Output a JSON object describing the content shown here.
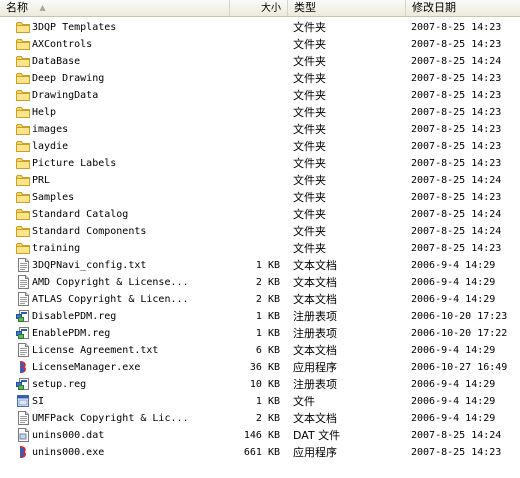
{
  "columns": {
    "name": "名称",
    "size": "大小",
    "type": "类型",
    "modified": "修改日期"
  },
  "files": [
    {
      "name": "3DQP Templates",
      "size": "",
      "type": "文件夹",
      "modified": "2007-8-25 14:23",
      "icon": "folder-icon"
    },
    {
      "name": "AXControls",
      "size": "",
      "type": "文件夹",
      "modified": "2007-8-25 14:23",
      "icon": "folder-icon"
    },
    {
      "name": "DataBase",
      "size": "",
      "type": "文件夹",
      "modified": "2007-8-25 14:24",
      "icon": "folder-icon"
    },
    {
      "name": "Deep Drawing",
      "size": "",
      "type": "文件夹",
      "modified": "2007-8-25 14:23",
      "icon": "folder-icon"
    },
    {
      "name": "DrawingData",
      "size": "",
      "type": "文件夹",
      "modified": "2007-8-25 14:23",
      "icon": "folder-icon"
    },
    {
      "name": "Help",
      "size": "",
      "type": "文件夹",
      "modified": "2007-8-25 14:23",
      "icon": "folder-icon"
    },
    {
      "name": "images",
      "size": "",
      "type": "文件夹",
      "modified": "2007-8-25 14:23",
      "icon": "folder-icon"
    },
    {
      "name": "laydie",
      "size": "",
      "type": "文件夹",
      "modified": "2007-8-25 14:23",
      "icon": "folder-icon"
    },
    {
      "name": "Picture Labels",
      "size": "",
      "type": "文件夹",
      "modified": "2007-8-25 14:23",
      "icon": "folder-icon"
    },
    {
      "name": "PRL",
      "size": "",
      "type": "文件夹",
      "modified": "2007-8-25 14:24",
      "icon": "folder-icon"
    },
    {
      "name": "Samples",
      "size": "",
      "type": "文件夹",
      "modified": "2007-8-25 14:23",
      "icon": "folder-icon"
    },
    {
      "name": "Standard Catalog",
      "size": "",
      "type": "文件夹",
      "modified": "2007-8-25 14:24",
      "icon": "folder-icon"
    },
    {
      "name": "Standard Components",
      "size": "",
      "type": "文件夹",
      "modified": "2007-8-25 14:24",
      "icon": "folder-icon"
    },
    {
      "name": "training",
      "size": "",
      "type": "文件夹",
      "modified": "2007-8-25 14:23",
      "icon": "folder-icon"
    },
    {
      "name": "3DQPNavi_config.txt",
      "size": "1 KB",
      "type": "文本文档",
      "modified": "2006-9-4 14:29",
      "icon": "text-file-icon"
    },
    {
      "name": "AMD Copyright & License...",
      "size": "2 KB",
      "type": "文本文档",
      "modified": "2006-9-4 14:29",
      "icon": "text-file-icon"
    },
    {
      "name": "ATLAS Copyright & Licen...",
      "size": "2 KB",
      "type": "文本文档",
      "modified": "2006-9-4 14:29",
      "icon": "text-file-icon"
    },
    {
      "name": "DisablePDM.reg",
      "size": "1 KB",
      "type": "注册表项",
      "modified": "2006-10-20 17:23",
      "icon": "registry-file-icon"
    },
    {
      "name": "EnablePDM.reg",
      "size": "1 KB",
      "type": "注册表项",
      "modified": "2006-10-20 17:22",
      "icon": "registry-file-icon"
    },
    {
      "name": "License Agreement.txt",
      "size": "6 KB",
      "type": "文本文档",
      "modified": "2006-9-4 14:29",
      "icon": "text-file-icon"
    },
    {
      "name": "LicenseManager.exe",
      "size": "36 KB",
      "type": "应用程序",
      "modified": "2006-10-27 16:49",
      "icon": "installer-exe-icon"
    },
    {
      "name": "setup.reg",
      "size": "10 KB",
      "type": "注册表项",
      "modified": "2006-9-4 14:29",
      "icon": "registry-file-icon"
    },
    {
      "name": "SI",
      "size": "1 KB",
      "type": "文件",
      "modified": "2006-9-4 14:29",
      "icon": "generic-file-icon"
    },
    {
      "name": "UMFPack Copyright & Lic...",
      "size": "2 KB",
      "type": "文本文档",
      "modified": "2006-9-4 14:29",
      "icon": "text-file-icon"
    },
    {
      "name": "unins000.dat",
      "size": "146 KB",
      "type": "DAT 文件",
      "modified": "2007-8-25 14:24",
      "icon": "dat-file-icon"
    },
    {
      "name": "unins000.exe",
      "size": "661 KB",
      "type": "应用程序",
      "modified": "2007-8-25 14:23",
      "icon": "installer-exe-icon"
    }
  ]
}
